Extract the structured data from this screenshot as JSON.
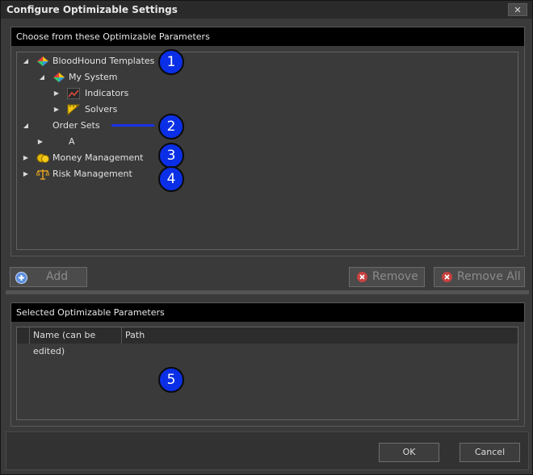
{
  "window": {
    "title": "Configure Optimizable Settings",
    "close_glyph": "✕"
  },
  "top_panel": {
    "header": "Choose from these Optimizable Parameters",
    "tree": [
      {
        "label": "BloodHound Templates",
        "expanded": true,
        "icon": "diamond-multicolor-icon"
      },
      {
        "label": "My System",
        "expanded": true,
        "icon": "diamond-multicolor-icon"
      },
      {
        "label": "Indicators",
        "expanded": false,
        "icon": "chart-icon"
      },
      {
        "label": "Solvers",
        "expanded": false,
        "icon": "ruler-icon"
      },
      {
        "label": "Order Sets",
        "expanded": true,
        "icon": "none"
      },
      {
        "label": "A",
        "expanded": false,
        "icon": "none"
      },
      {
        "label": "Money Management",
        "expanded": false,
        "icon": "coins-icon"
      },
      {
        "label": "Risk Management",
        "expanded": false,
        "icon": "scales-icon"
      }
    ]
  },
  "buttons": {
    "add": "Add",
    "remove": "Remove",
    "remove_all": "Remove All"
  },
  "bottom_panel": {
    "header": "Selected Optimizable Parameters",
    "columns": [
      "",
      "Name (can be edited)",
      "Path"
    ]
  },
  "footer": {
    "ok": "OK",
    "cancel": "Cancel"
  },
  "callouts": [
    "1",
    "2",
    "3",
    "4",
    "5"
  ],
  "colors": {
    "callout": "#0b2fe6",
    "header_bg": "#000000",
    "panel_bg": "#3a3a3a"
  }
}
